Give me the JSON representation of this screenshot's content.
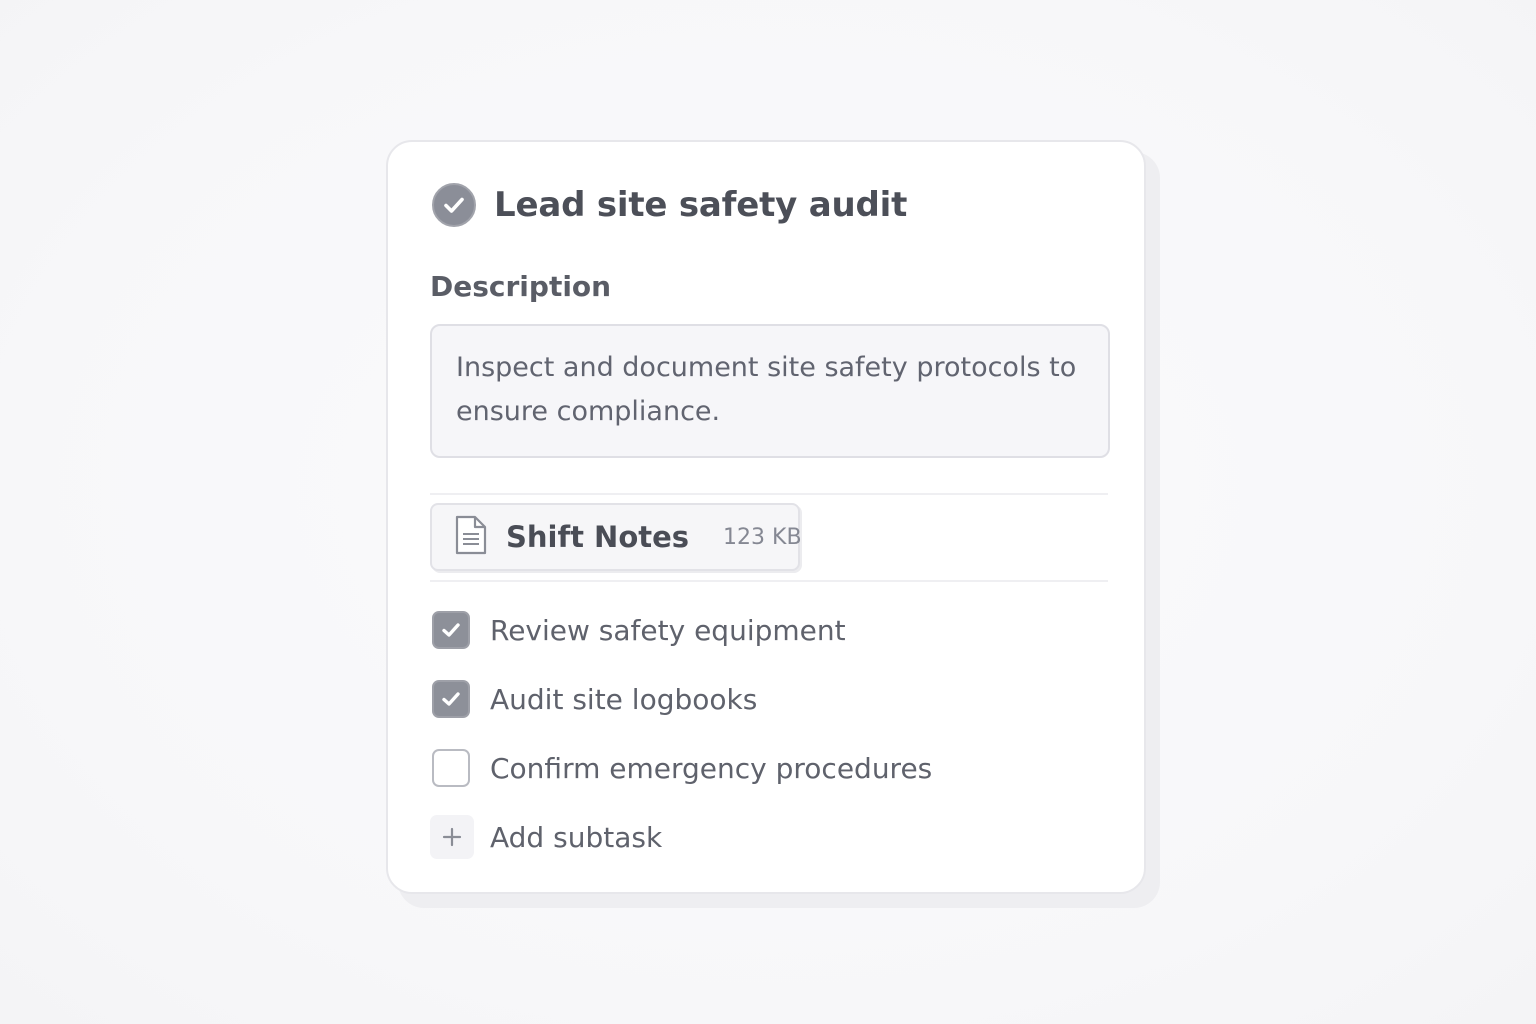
{
  "task": {
    "title": "Lead site safety audit",
    "completed": true,
    "icon": "check-circle-icon"
  },
  "description": {
    "label": "Description",
    "text": "Inspect and document site safety protocols to ensure compliance."
  },
  "attachment": {
    "icon": "document-icon",
    "name": "Shift Notes",
    "size": "123 KB"
  },
  "subtasks": [
    {
      "label": "Review safety equipment",
      "checked": true
    },
    {
      "label": "Audit site logbooks",
      "checked": true
    },
    {
      "label": "Confirm emergency procedures",
      "checked": false
    }
  ],
  "add_subtask": {
    "label": "Add subtask",
    "icon": "plus-icon"
  },
  "colors": {
    "checked": "#8d9099",
    "text": "#4c4f58",
    "card": "#ffffff",
    "background": "#f8f8fa"
  }
}
